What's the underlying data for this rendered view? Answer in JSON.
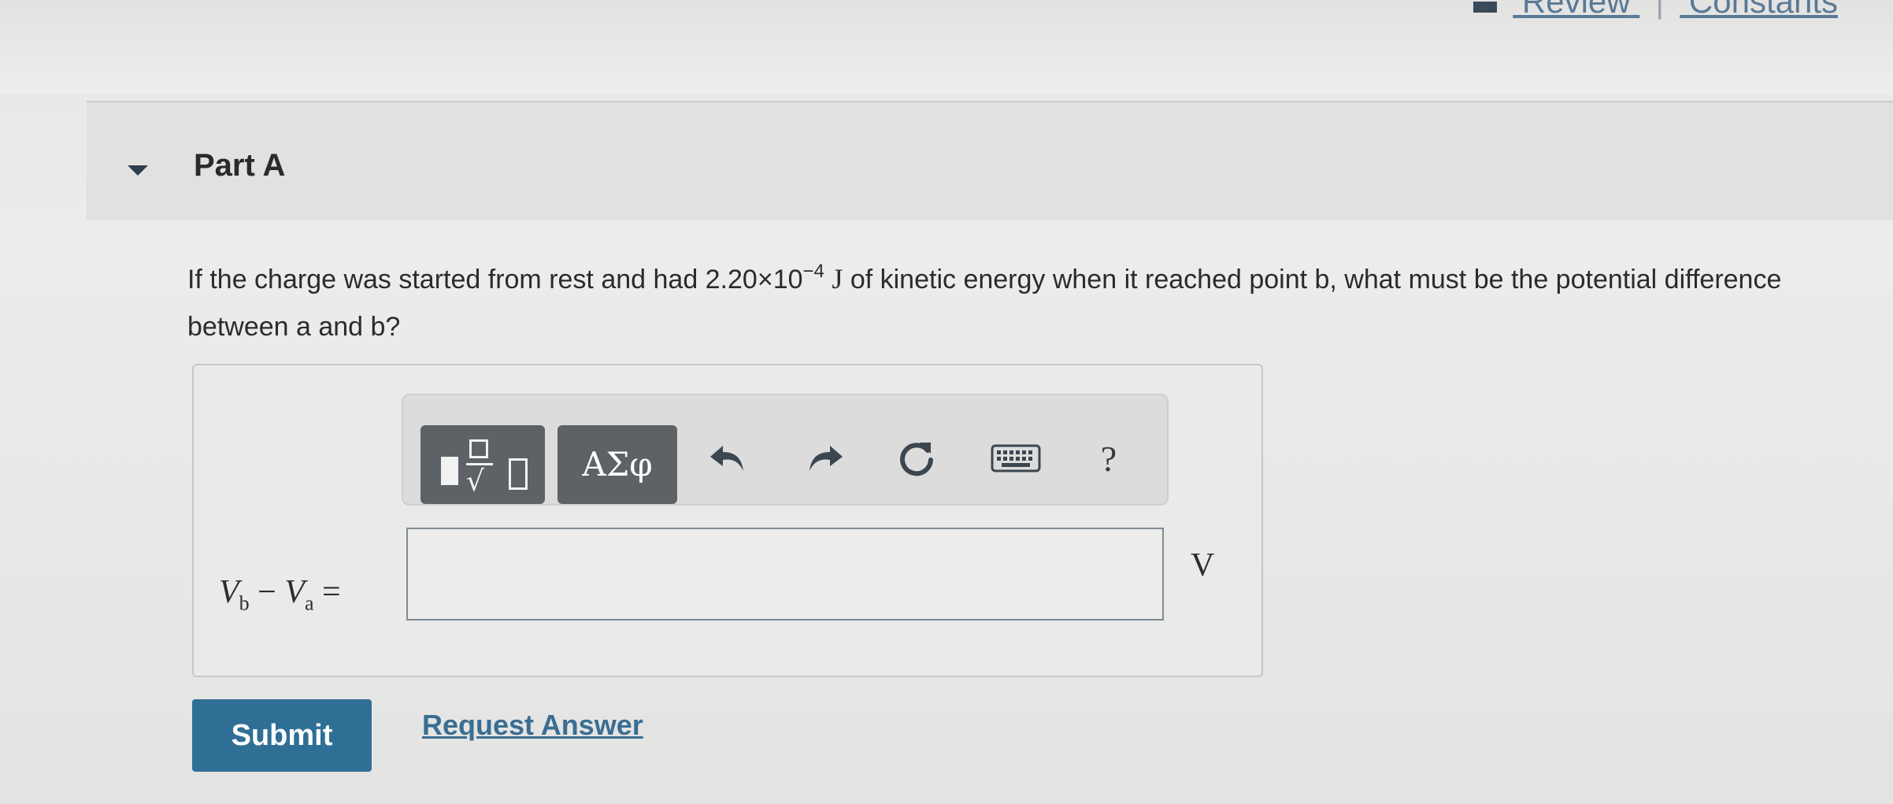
{
  "top_links": {
    "review": "Review",
    "separator": "|",
    "constants": "Constants"
  },
  "part": {
    "title": "Part A"
  },
  "question": {
    "text_before": "If the charge was started from rest and had ",
    "value_mantissa": "2.20×10",
    "value_exponent": "−4",
    "value_unit": "J",
    "text_after": " of kinetic energy when it reached point b, what must be the potential difference between a and b?"
  },
  "toolbar": {
    "templates_label": "√",
    "symbols_label": "ΑΣφ",
    "help_label": "?"
  },
  "equation": {
    "v1": "V",
    "sub1": "b",
    "minus": " − ",
    "v2": "V",
    "sub2": "a",
    "equals": " ="
  },
  "answer": {
    "value": "",
    "placeholder": "",
    "unit": "V"
  },
  "actions": {
    "submit_label": "Submit",
    "request_answer_label": "Request Answer"
  },
  "icons": {
    "undo": "undo-icon",
    "redo": "redo-icon",
    "reset": "reset-icon",
    "keyboard": "keyboard-icon",
    "caret": "caret-down-icon"
  },
  "colors": {
    "submit_bg": "#2f6f95",
    "link": "#3a6e92",
    "toolbar_dark_button": "#5d6266"
  }
}
